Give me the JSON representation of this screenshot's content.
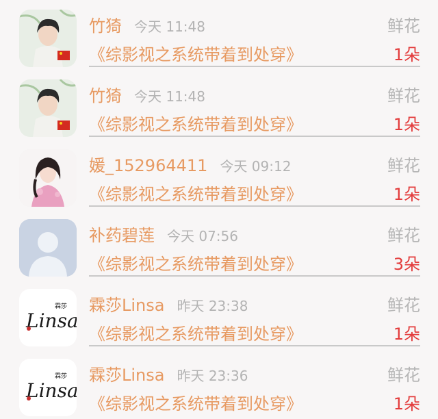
{
  "items": [
    {
      "avatar": "man-portrait-avatar",
      "name": "竹猗",
      "time": "今天 11:48",
      "gift": "鲜花",
      "book": "《综影视之系统带着到处穿》",
      "count": "1朵"
    },
    {
      "avatar": "man-portrait-avatar",
      "name": "竹猗",
      "time": "今天 11:48",
      "gift": "鲜花",
      "book": "《综影视之系统带着到处穿》",
      "count": "1朵"
    },
    {
      "avatar": "woman-illustration-avatar",
      "name": "媛_152964411",
      "time": "今天 09:12",
      "gift": "鲜花",
      "book": "《综影视之系统带着到处穿》",
      "count": "1朵"
    },
    {
      "avatar": "default-user-avatar",
      "name": "补药碧莲",
      "time": "今天 07:56",
      "gift": "鲜花",
      "book": "《综影视之系统带着到处穿》",
      "count": "3朵"
    },
    {
      "avatar": "linsa-logo-avatar",
      "avatar_text": "霖莎 Linsa",
      "name": "霖莎Linsa",
      "time": "昨天 23:38",
      "gift": "鲜花",
      "book": "《综影视之系统带着到处穿》",
      "count": "1朵"
    },
    {
      "avatar": "linsa-logo-avatar",
      "avatar_text": "霖莎 Linsa",
      "name": "霖莎Linsa",
      "time": "昨天 23:36",
      "gift": "鲜花",
      "book": "《综影视之系统带着到处穿》",
      "count": "1朵"
    }
  ],
  "colors": {
    "background": "#f8f6f6",
    "name_color": "#e79a62",
    "time_color": "#b3b3b3",
    "gift_label_color": "#b6b6b6",
    "count_color": "#e33c3c",
    "divider": "#c9c9c9"
  }
}
